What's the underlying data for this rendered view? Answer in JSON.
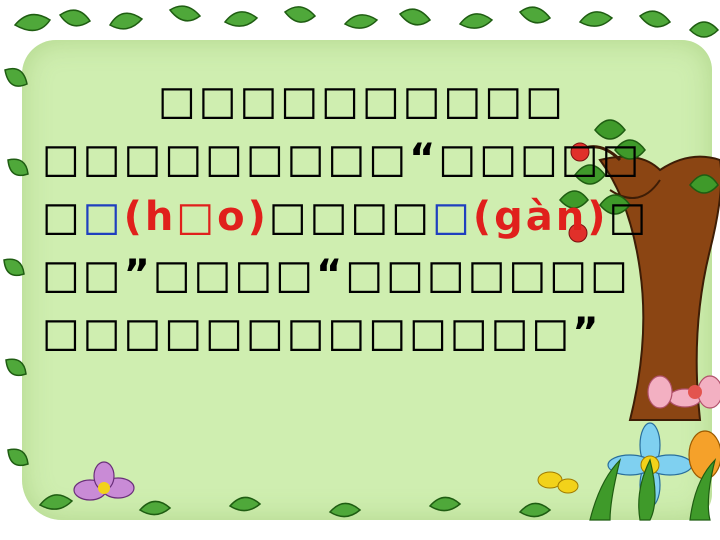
{
  "slide": {
    "lines": [
      {
        "t": "□□□□□□□□□□"
      },
      {
        "t": "□□□□□□□□□“□□□□□"
      },
      {
        "p1": "□",
        "blue1": "□",
        "red1a": "(h",
        "red1box": "□",
        "red1b": "o)",
        "mid": "□□□□",
        "blue2": "□",
        "red2": "(gàn)",
        "p2": "□"
      },
      {
        "t": "□□”□□□□“□□□□□□□"
      },
      {
        "t": "□□□□□□□□□□□□□”"
      }
    ]
  },
  "colors": {
    "panel": "#cfeeb0",
    "trunk": "#8b4513",
    "leaf": "#3f9a2a",
    "apple": "#e0302a",
    "highlight_blue": "#1f3fbf",
    "highlight_red": "#e0201c"
  },
  "decor": {
    "left_icon": "leaf-frame-icon",
    "tree": "tree-icon",
    "flowers": "flower-cluster-icon"
  }
}
